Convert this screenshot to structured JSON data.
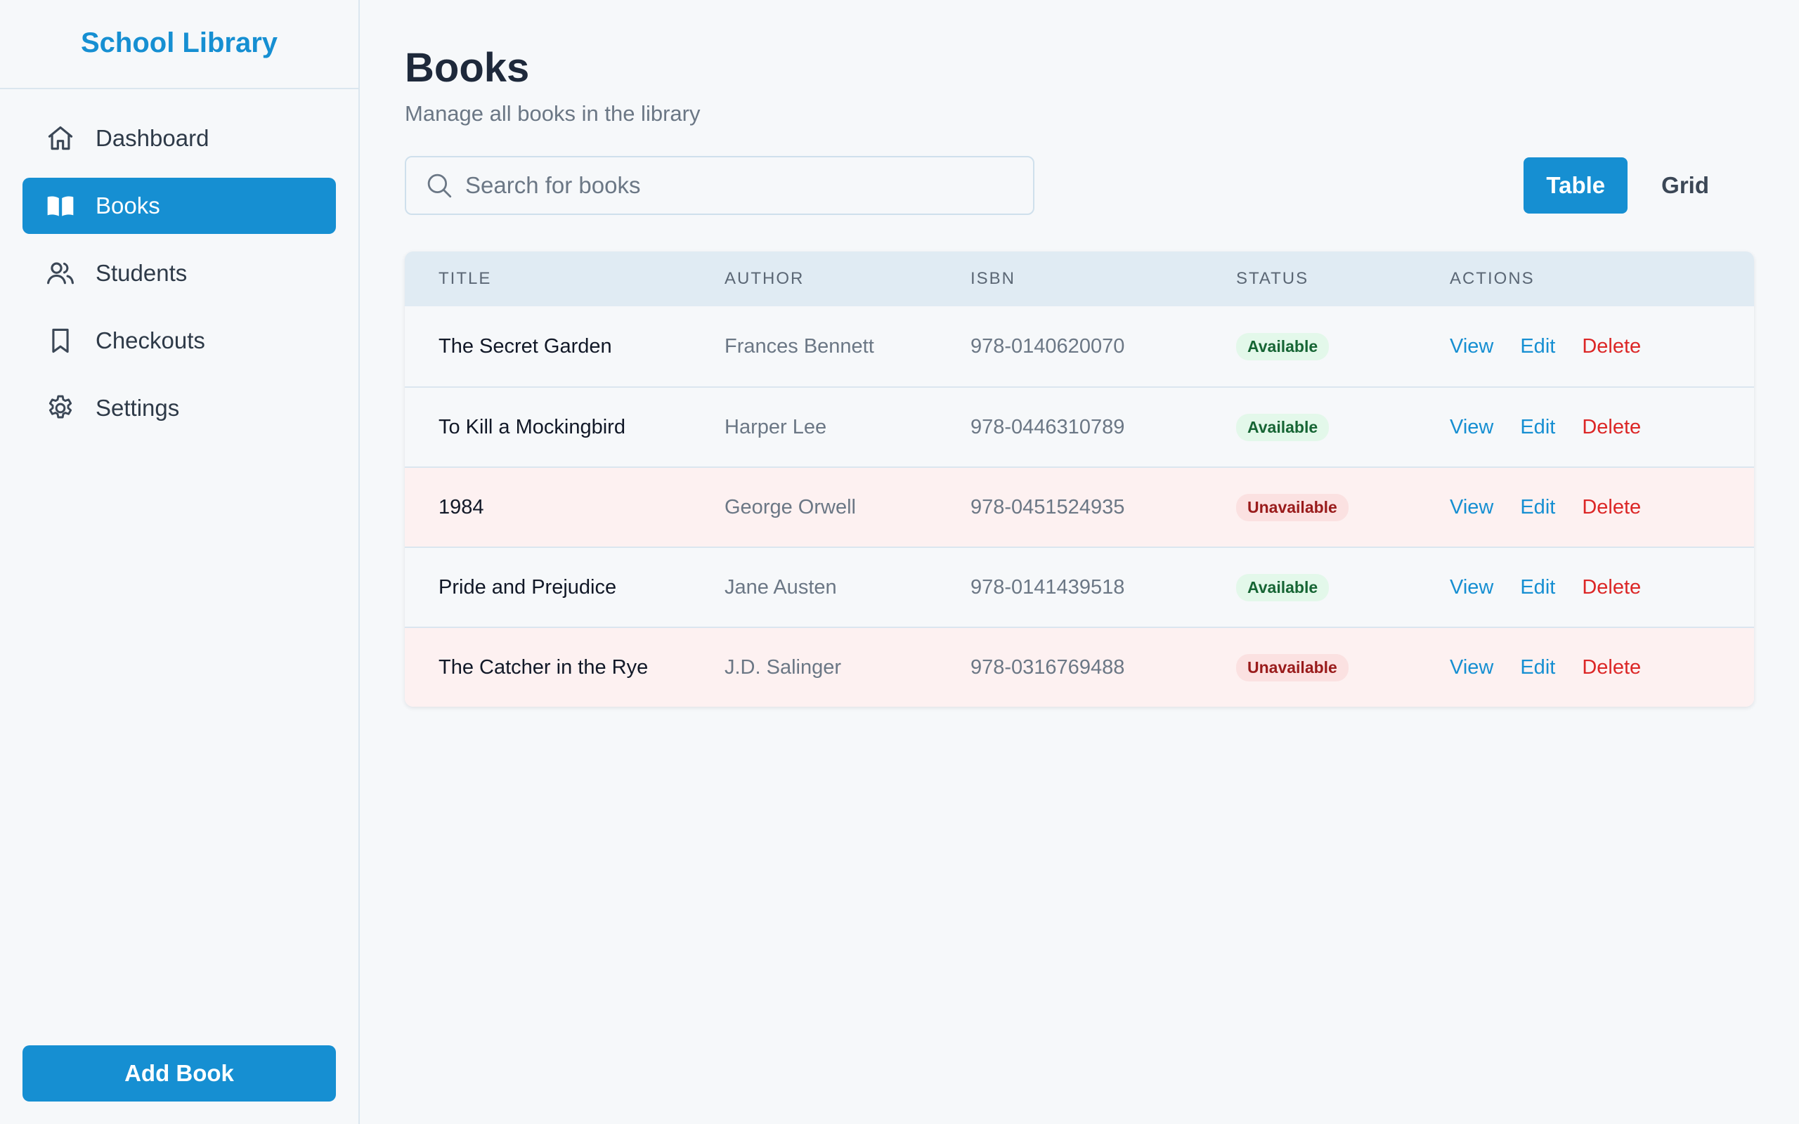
{
  "brand": {
    "title": "School Library"
  },
  "sidebar": {
    "items": [
      {
        "label": "Dashboard",
        "icon": "home-icon",
        "active": false
      },
      {
        "label": "Books",
        "icon": "book-open-icon",
        "active": true
      },
      {
        "label": "Students",
        "icon": "users-icon",
        "active": false
      },
      {
        "label": "Checkouts",
        "icon": "bookmark-icon",
        "active": false
      },
      {
        "label": "Settings",
        "icon": "gear-icon",
        "active": false
      }
    ],
    "add_button": "Add Book"
  },
  "page": {
    "title": "Books",
    "subtitle": "Manage all books in the library"
  },
  "search": {
    "placeholder": "Search for books",
    "value": ""
  },
  "view_toggle": {
    "table_label": "Table",
    "grid_label": "Grid",
    "selected": "Table"
  },
  "table": {
    "headers": {
      "title": "TITLE",
      "author": "AUTHOR",
      "isbn": "ISBN",
      "status": "STATUS",
      "actions": "ACTIONS"
    },
    "rows": [
      {
        "title": "The Secret Garden",
        "author": "Frances Bennett",
        "isbn": "978-0140620070",
        "status": "Available",
        "view": "View",
        "edit": "Edit",
        "delete": "Delete"
      },
      {
        "title": "To Kill a Mockingbird",
        "author": "Harper Lee",
        "isbn": "978-0446310789",
        "status": "Available",
        "view": "View",
        "edit": "Edit",
        "delete": "Delete"
      },
      {
        "title": "1984",
        "author": "George Orwell",
        "isbn": "978-0451524935",
        "status": "Unavailable",
        "view": "View",
        "edit": "Edit",
        "delete": "Delete"
      },
      {
        "title": "Pride and Prejudice",
        "author": "Jane Austen",
        "isbn": "978-0141439518",
        "status": "Available",
        "view": "View",
        "edit": "Edit",
        "delete": "Delete"
      },
      {
        "title": "The Catcher in the Rye",
        "author": "J.D. Salinger",
        "isbn": "978-0316769488",
        "status": "Unavailable",
        "view": "View",
        "edit": "Edit",
        "delete": "Delete"
      }
    ]
  },
  "colors": {
    "accent": "#168fd2",
    "available_bg": "#e3f8ea",
    "available_text": "#166534",
    "unavailable_bg": "#fbe1e1",
    "unavailable_text": "#991b1b",
    "unavailable_row_bg": "#fdf1f1",
    "delete": "#dc2626"
  }
}
